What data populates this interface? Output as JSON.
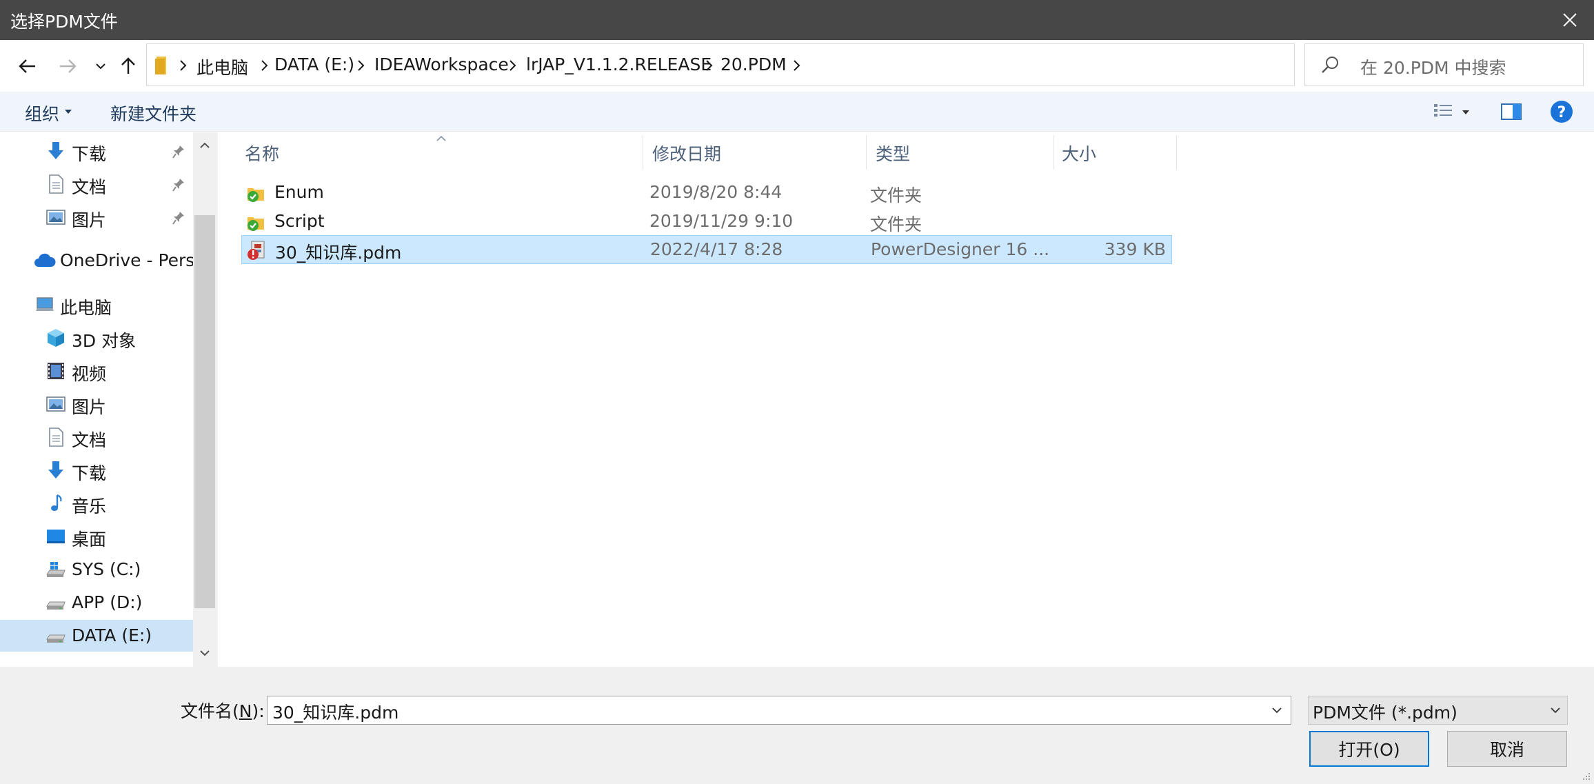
{
  "window": {
    "title": "选择PDM文件"
  },
  "address": {
    "crumbs": [
      "此电脑",
      "DATA (E:)",
      "IDEAWorkspace",
      "lrJAP_V1.1.2.RELEASE",
      "20.PDM"
    ],
    "search_placeholder": "在 20.PDM 中搜索"
  },
  "toolbar": {
    "organize": "组织",
    "new_folder": "新建文件夹"
  },
  "sidebar": {
    "items": [
      {
        "label": "下载",
        "icon": "download-arrow-icon",
        "pinned": true
      },
      {
        "label": "文档",
        "icon": "document-icon",
        "pinned": true
      },
      {
        "label": "图片",
        "icon": "pictures-icon",
        "pinned": true
      },
      {
        "label": "OneDrive - Perso",
        "icon": "cloud-icon"
      },
      {
        "label": "此电脑",
        "icon": "computer-icon"
      },
      {
        "label": "3D 对象",
        "icon": "cube-3d-icon"
      },
      {
        "label": "视频",
        "icon": "film-icon"
      },
      {
        "label": "图片",
        "icon": "pictures-icon"
      },
      {
        "label": "文档",
        "icon": "document-icon"
      },
      {
        "label": "下载",
        "icon": "download-arrow-icon"
      },
      {
        "label": "音乐",
        "icon": "music-note-icon"
      },
      {
        "label": "桌面",
        "icon": "desktop-icon"
      },
      {
        "label": "SYS (C:)",
        "icon": "windows-drive-icon"
      },
      {
        "label": "APP (D:)",
        "icon": "drive-icon"
      },
      {
        "label": "DATA (E:)",
        "icon": "drive-icon",
        "selected": true
      }
    ]
  },
  "filelist": {
    "columns": {
      "name": "名称",
      "date": "修改日期",
      "type": "类型",
      "size": "大小"
    },
    "rows": [
      {
        "name": "Enum",
        "date": "2019/8/20 8:44",
        "type": "文件夹",
        "size": "",
        "icon": "folder-sync-ok-icon"
      },
      {
        "name": "Script",
        "date": "2019/11/29 9:10",
        "type": "文件夹",
        "size": "",
        "icon": "folder-sync-ok-icon"
      },
      {
        "name": "30_知识库.pdm",
        "date": "2022/4/17 8:28",
        "type": "PowerDesigner 16 ...",
        "size": "339 KB",
        "icon": "pdm-file-conflict-icon",
        "selected": true
      }
    ]
  },
  "bottom": {
    "filename_label_prefix": "文件名(",
    "filename_label_key": "N",
    "filename_label_suffix": "):",
    "filename_value": "30_知识库.pdm",
    "filetype_value": "PDM文件 (*.pdm)",
    "open_label": "打开(O)",
    "cancel_label": "取消"
  }
}
